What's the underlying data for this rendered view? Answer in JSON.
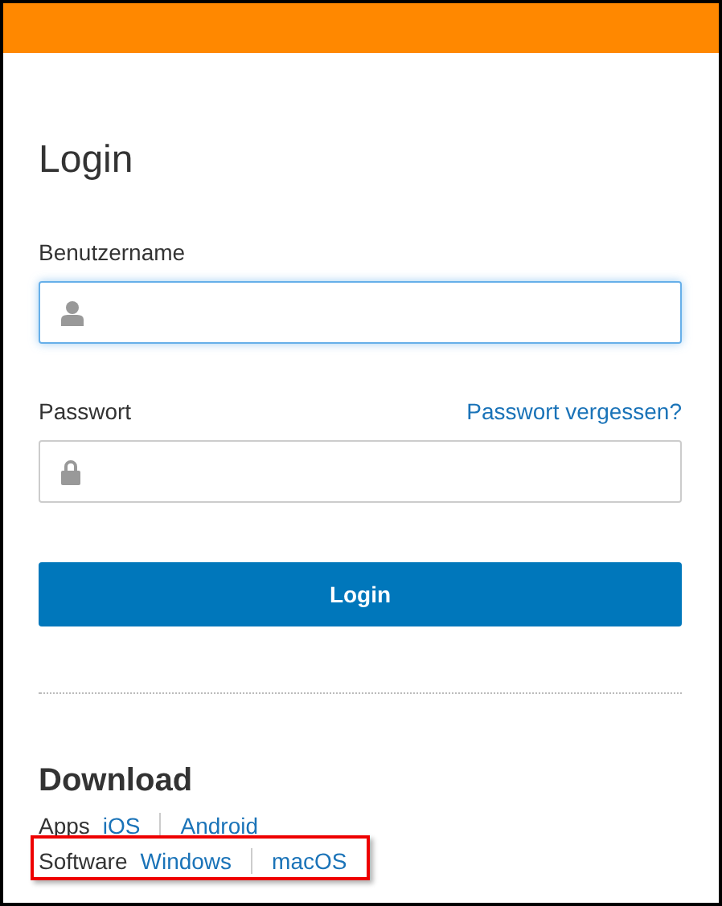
{
  "title": "Login",
  "fields": [
    {
      "label": "Benutzername",
      "kind": "username",
      "focused": true
    },
    {
      "label": "Passwort",
      "kind": "password",
      "focused": false,
      "link": "Passwort vergessen?"
    }
  ],
  "login_button": "Login",
  "download": {
    "title": "Download",
    "rows": [
      {
        "label": "Apps",
        "links": [
          "iOS",
          "Android"
        ],
        "highlighted": false
      },
      {
        "label": "Software",
        "links": [
          "Windows",
          "macOS"
        ],
        "highlighted": true
      }
    ]
  }
}
